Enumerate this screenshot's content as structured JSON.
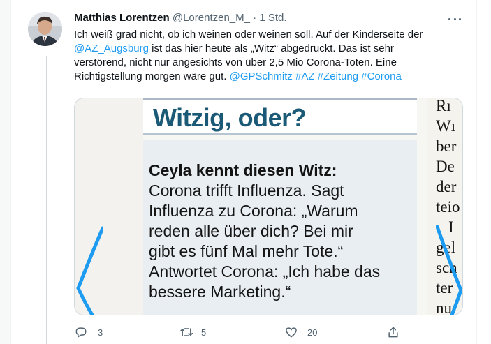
{
  "tweet": {
    "author_name": "Matthias Lorentzen",
    "handle": "@Lorentzen_M_",
    "separator": "·",
    "time": "1 Std.",
    "text": {
      "line1": "Ich weiß grad nicht, ob ich weinen oder weinen soll. Auf der Kinderseite der",
      "mention_az": "@AZ_Augsburg",
      "line2_rest": " ist das hier heute als „Witz“ abgedruckt. Das ist sehr",
      "line3": "verstörend, nicht nur angesichts von über 2,5 Mio Corona-Toten. Eine",
      "line4_start": "Richtigstellung morgen wäre gut. ",
      "tags": "@GPSchmitz #AZ #Zeitung #Corona"
    }
  },
  "media": {
    "headline": "Witzig, oder?",
    "joke_title": "Ceyla kennt diesen Witz:",
    "joke_lines": [
      "Corona trifft Influenza. Sagt",
      "Influenza zu Corona: „Warum",
      "reden alle über dich? Bei mir",
      "gibt es fünf Mal mehr Tote.“",
      "Antwortet Corona: „Ich habe das",
      "bessere Marketing.“"
    ],
    "right_column_fragments": [
      "Rı",
      "Wı",
      "ber",
      "De",
      "der",
      "teio",
      "I",
      "gel",
      "sch",
      "ter",
      "nu"
    ]
  },
  "actions": {
    "replies": "3",
    "retweets": "5",
    "likes": "20"
  },
  "colors": {
    "link": "#1d9bf0",
    "headline": "#1b5a76",
    "annotation_stroke": "#1d9bf0",
    "secondary_text": "#536471"
  },
  "icons": [
    "more-icon",
    "reply-icon",
    "retweet-icon",
    "like-icon",
    "share-icon"
  ]
}
